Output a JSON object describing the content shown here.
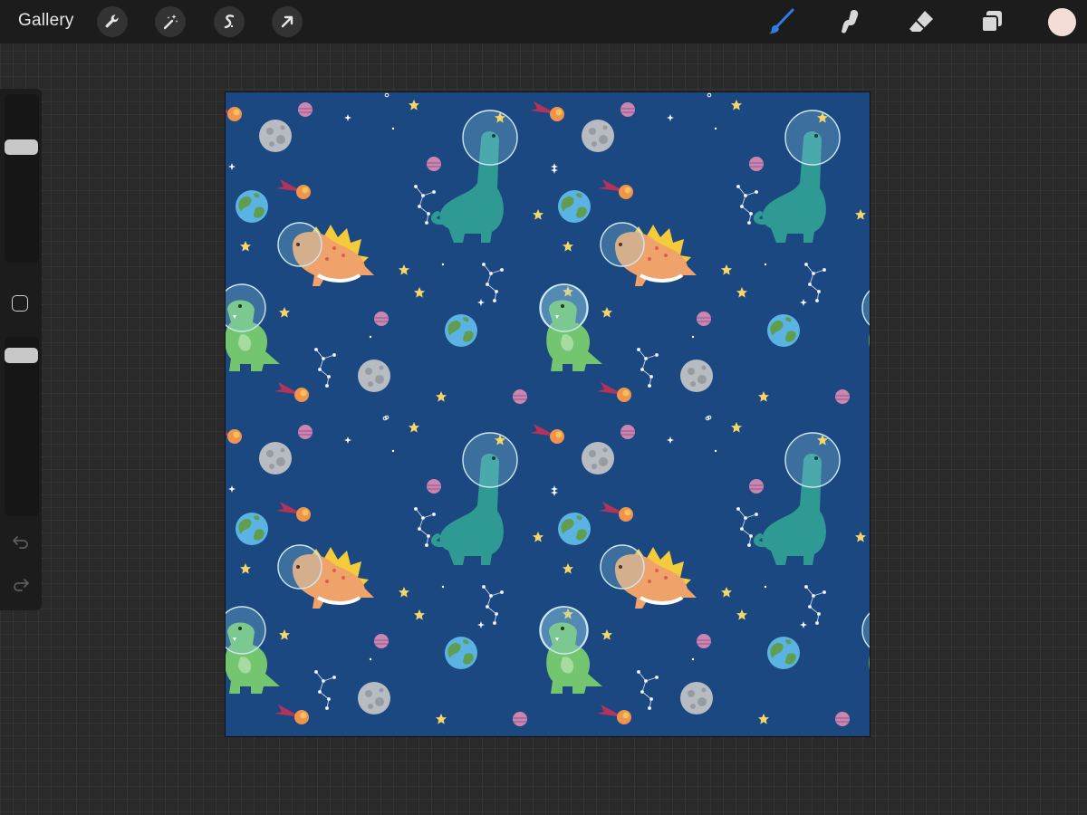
{
  "topbar": {
    "gallery_label": "Gallery",
    "left_tools": [
      "wrench-icon",
      "magic-wand-icon",
      "selection-icon",
      "transform-arrow-icon"
    ],
    "right_tools": [
      "brush-icon",
      "smudge-icon",
      "eraser-icon",
      "layers-icon"
    ],
    "active_tool": "brush-icon",
    "accent_color": "#2f7de1",
    "current_color": "#f3ddd6"
  },
  "sidebar": {
    "controls": [
      "brush-size-slider",
      "modify-button",
      "opacity-slider",
      "undo-icon",
      "redo-icon"
    ]
  },
  "canvas": {
    "background": "#1c4881",
    "pattern": [
      "astronaut-stegosaurus",
      "astronaut-brachiosaurus",
      "astronaut-t-rex",
      "earth",
      "moon",
      "planet",
      "comet",
      "star",
      "constellation"
    ]
  }
}
